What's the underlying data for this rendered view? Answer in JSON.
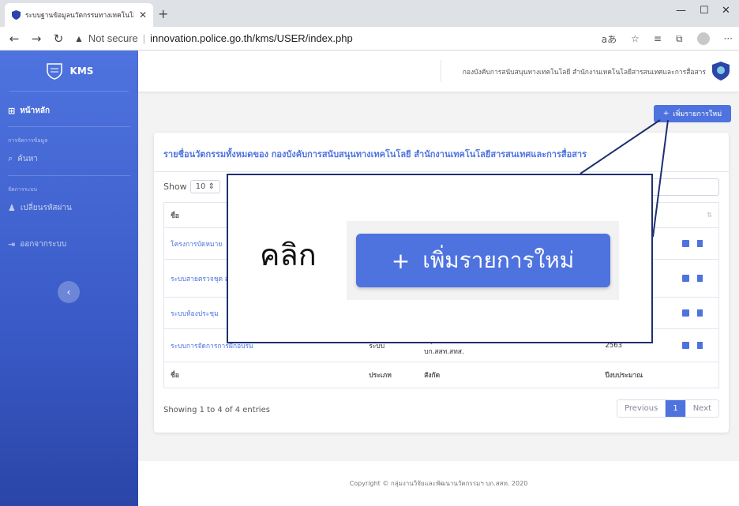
{
  "browser": {
    "tab_title": "ระบบฐานข้อมูลนวัตกรรมทางเทคโนโลยี",
    "security_label": "Not secure",
    "separator": "|",
    "url": "innovation.police.go.th/kms/USER/index.php"
  },
  "sidebar": {
    "brand": "KMS",
    "home": "หน้าหลัก",
    "section_data": "การจัดการข้อมูล",
    "search": "ค้นหา",
    "section_system": "จัดการระบบ",
    "change_password": "เปลี่ยนรหัสผ่าน",
    "logout": "ออกจากระบบ"
  },
  "topbar": {
    "org_text": "กองบังคับการสนับสนุนทางเทคโนโลยี สำนักงานเทคโนโลยีสารสนเทศและการสื่อสาร"
  },
  "add_button": {
    "label": "เพิ่มรายการใหม่"
  },
  "card": {
    "title": "รายชื่อนวัตกรรมทั้งหมดของ กองบังคับการสนับสนุนทางเทคโนโลยี สำนักงานเทคโนโลยีสารสนเทศและการสื่อสาร",
    "show_label": "Show",
    "show_value": "10"
  },
  "table": {
    "header_name": "ชื่อ",
    "footer": [
      "ชื่อ",
      "ประเภท",
      "สังกัด",
      "ปีงบประมาณ"
    ],
    "rows": [
      {
        "name": "โครงการบัดหมาย"
      },
      {
        "name": "ระบบสายตรวจชุด สัญญาณ 5G"
      },
      {
        "name": "ระบบห้องประชุม"
      },
      {
        "name": "ระบบการจัดการการฝึกอบรม",
        "type": "ระบบ",
        "unit": "กลุ่มงานวิจัยและพัฒนานวัตกรรมทางเทคโนโลยี บก.สสท.สทส.",
        "year": "2563"
      }
    ],
    "info": "Showing 1 to 4 of 4 entries",
    "pager": [
      "Previous",
      "1",
      "Next"
    ]
  },
  "footer": {
    "copyright": "Copyright © กลุ่มงานวิจัยและพัฒนานวัตกรรมฯ บก.สสท. 2020"
  },
  "callout": {
    "word": "คลิก",
    "zoom_button_label": "เพิ่มรายการใหม่"
  },
  "colors": {
    "accent": "#4e73df",
    "callout_border": "#1f2f6e"
  }
}
